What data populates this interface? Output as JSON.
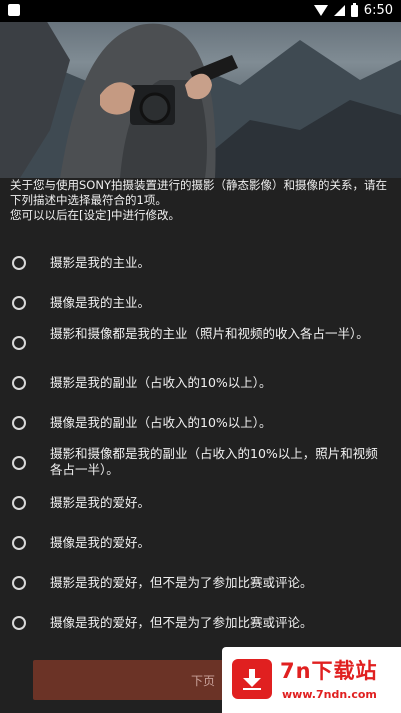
{
  "status_bar": {
    "time": "6:50"
  },
  "intro": {
    "line1": "关于您与使用SONY拍摄装置进行的摄影（静态影像）和摄像的关系，请在下列描述中选择最符合的1项。",
    "line2": "您可以以后在[设定]中进行修改。"
  },
  "options": [
    {
      "label": "摄影是我的主业。"
    },
    {
      "label": "摄像是我的主业。"
    },
    {
      "label": "摄影和摄像都是我的主业（照片和视频的收入各占一半）。"
    },
    {
      "label": "摄影是我的副业（占收入的10%以上）。"
    },
    {
      "label": "摄像是我的副业（占收入的10%以上）。"
    },
    {
      "label": "摄影和摄像都是我的副业（占收入的10%以上，照片和视频各占一半）。"
    },
    {
      "label": "摄影是我的爱好。"
    },
    {
      "label": "摄像是我的爱好。"
    },
    {
      "label": "摄影是我的爱好，但不是为了参加比赛或评论。"
    },
    {
      "label": "摄像是我的爱好，但不是为了参加比赛或评论。"
    }
  ],
  "next_button": {
    "label": "下页"
  },
  "watermark": {
    "brand": "7n下载站",
    "url": "www.7ndn.com"
  },
  "colors": {
    "background": "#212121",
    "button": "#6b3326",
    "watermark_red": "#e02020"
  }
}
